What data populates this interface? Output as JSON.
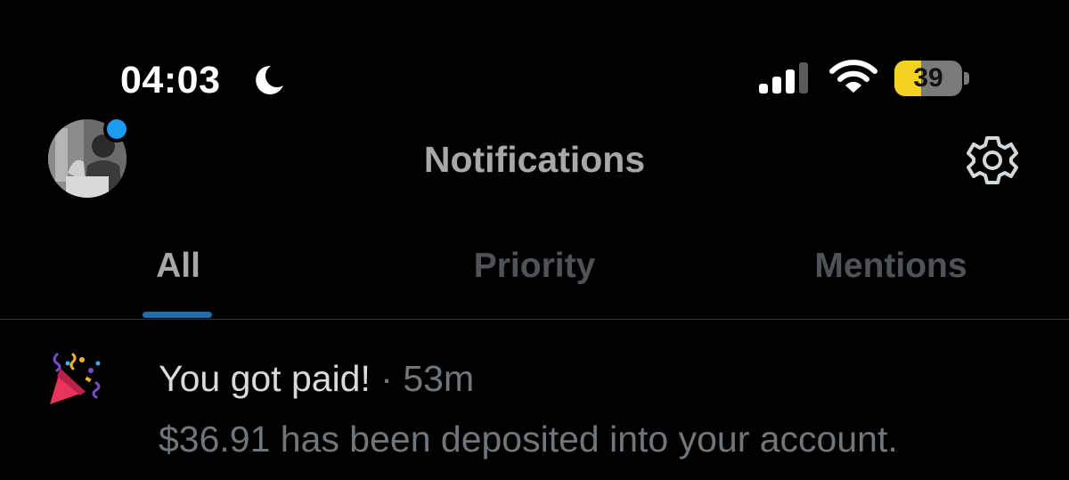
{
  "status_bar": {
    "time": "04:03",
    "battery_percent": "39",
    "battery_level": 0.39,
    "icons": [
      "moon-icon",
      "cellular-signal-icon",
      "wifi-icon",
      "battery-icon"
    ]
  },
  "header": {
    "title": "Notifications",
    "settings_icon": "gear-icon",
    "avatar_has_indicator": true
  },
  "tabs": [
    {
      "label": "All",
      "selected": true
    },
    {
      "label": "Priority",
      "selected": false
    },
    {
      "label": "Mentions",
      "selected": false
    }
  ],
  "notifications": [
    {
      "icon": "party-popper-icon",
      "title": "You got paid!",
      "separator": "·",
      "time": "53m",
      "body": "$36.91 has been deposited into your account."
    }
  ],
  "colors": {
    "background": "#000000",
    "accent": "#1d9bf0",
    "muted_text": "#71767b",
    "battery_low_power": "#f5d21f"
  }
}
